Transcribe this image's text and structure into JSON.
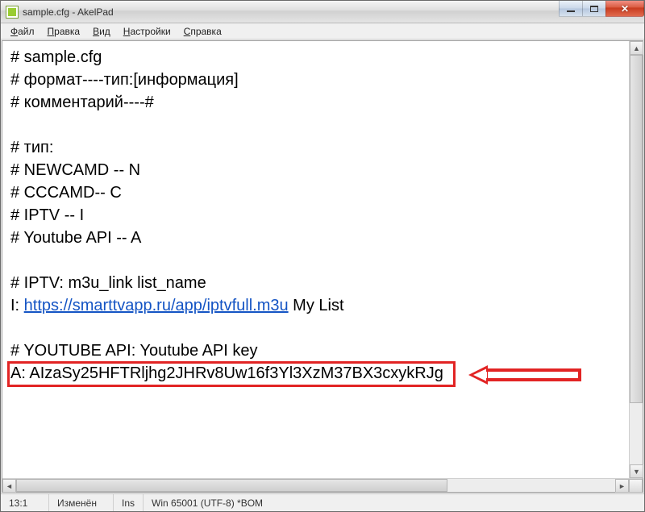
{
  "titlebar": {
    "title": "sample.cfg - AkelPad"
  },
  "menu": {
    "file": "Файл",
    "edit": "Правка",
    "view": "Вид",
    "settings": "Настройки",
    "help": "Справка"
  },
  "editor": {
    "l1": "# sample.cfg",
    "l2": "# формат----тип:[информация]",
    "l3": "# комментарий----#",
    "l4": "",
    "l5": "# тип:",
    "l6": "# NEWCAMD -- N",
    "l7": "# CCCAMD-- C",
    "l8": "# IPTV -- I",
    "l9": "# Youtube API -- A",
    "l10": "",
    "l11": "# IPTV: m3u_link list_name",
    "l12_prefix": "I: ",
    "l12_link": "https://smarttvapp.ru/app/iptvfull.m3u",
    "l12_suffix": " My List",
    "l13": "",
    "l14": "# YOUTUBE API: Youtube API key",
    "l15": "A: AIzaSy25HFTRljhg2JHRv8Uw16f3Yl3XzM37BX3cxykRJg"
  },
  "status": {
    "cursor": "13:1",
    "modified": "Изменён",
    "insert": "Ins",
    "encoding": "Win 65001 (UTF-8)  *BOM"
  }
}
